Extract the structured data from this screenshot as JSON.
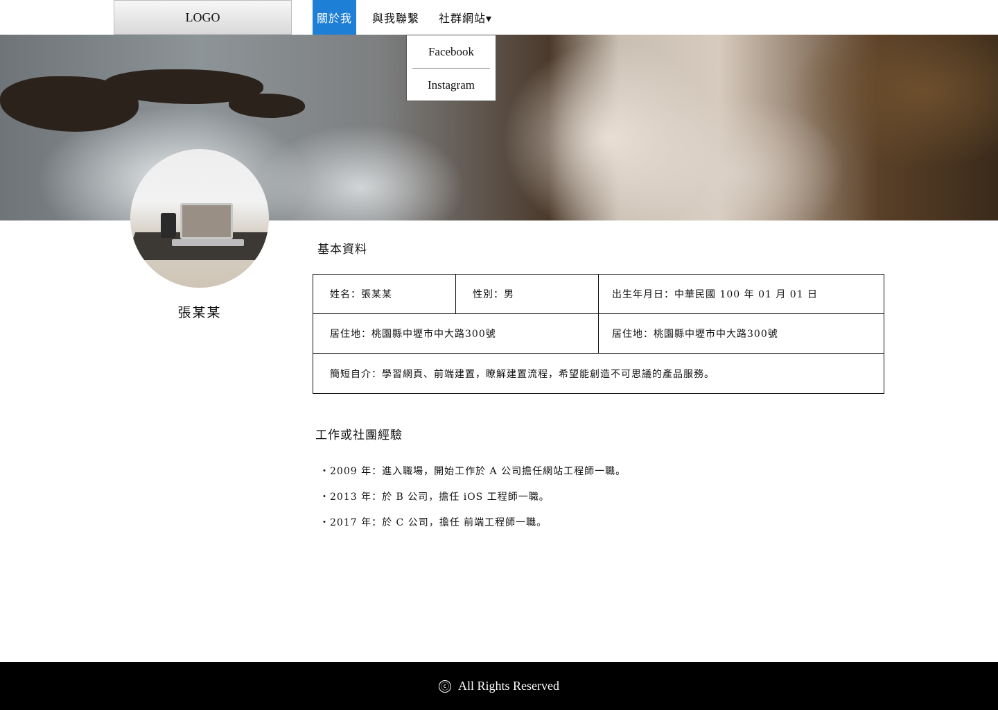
{
  "header": {
    "logo": "LOGO",
    "nav": [
      {
        "label": "關於我",
        "active": true
      },
      {
        "label": "與我聯繫",
        "active": false
      },
      {
        "label": "社群網站▾",
        "active": false
      }
    ],
    "dropdown": [
      "Facebook",
      "Instagram"
    ],
    "active_color": "#1e7fd6"
  },
  "profile": {
    "name": "張某某"
  },
  "basic": {
    "title": "基本資料",
    "name": "姓名：張某某",
    "gender": "性別：男",
    "birth": "出生年月日：中華民國 100 年 01 月 01 日",
    "address1": "居住地：桃園縣中壢市中大路300號",
    "address2": "居住地：桃園縣中壢市中大路300號",
    "intro": "簡短自介：學習網頁、前端建置，瞭解建置流程，希望能創造不可思議的產品服務。"
  },
  "experience": {
    "title": "工作或社團經驗",
    "items": [
      "・2009 年：進入職場，開始工作於 A 公司擔任網站工程師一職。",
      "・2013 年：於 B 公司，擔任 iOS 工程師一職。",
      "・2017 年：於 C 公司，擔任 前端工程師一職。"
    ]
  },
  "footer": {
    "copyright_icon": "ⓒ",
    "text": "All Rights Reserved"
  }
}
